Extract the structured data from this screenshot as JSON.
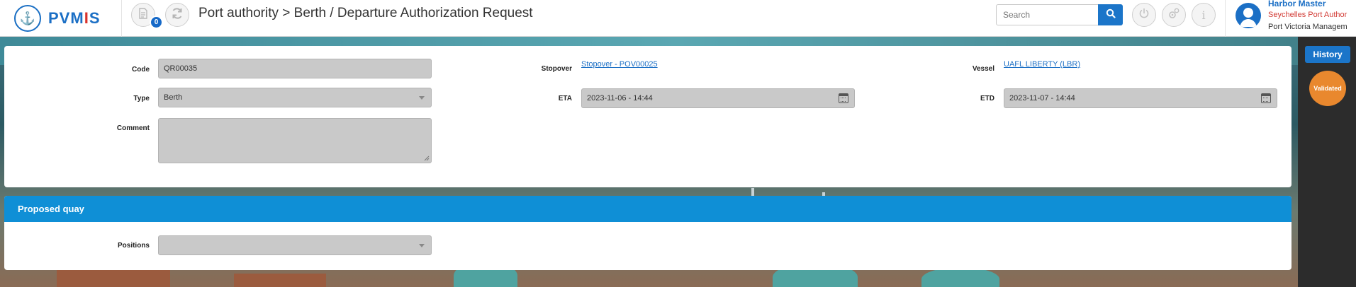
{
  "app": {
    "name_blue": "PVM",
    "name_red": "I",
    "name_tail": "S"
  },
  "header": {
    "title": "Port authority > Berth / Departure Authorization Request",
    "notification_count": "0",
    "search_placeholder": "Search"
  },
  "user": {
    "role": "Harbor Master",
    "organization": "Seychelles Port Author",
    "unit": "Port Victoria Managem"
  },
  "side": {
    "history_label": "History",
    "status": "Validated"
  },
  "form": {
    "code_label": "Code",
    "code_value": "QR00035",
    "type_label": "Type",
    "type_value": "Berth",
    "comment_label": "Comment",
    "comment_value": "",
    "stopover_label": "Stopover",
    "stopover_link": "Stopover - POV00025",
    "eta_label": "ETA",
    "eta_value": "2023-11-06 - 14:44",
    "vessel_label": "Vessel",
    "vessel_link": "UAFL LIBERTY (LBR)",
    "etd_label": "ETD",
    "etd_value": "2023-11-07 - 14:44"
  },
  "quay": {
    "title": "Proposed quay",
    "positions_label": "Positions",
    "positions_value": ""
  },
  "colors": {
    "accent": "#1b75c9",
    "section_header": "#0f8fd6",
    "status": "#e9882e",
    "logo_red": "#d9312b"
  }
}
